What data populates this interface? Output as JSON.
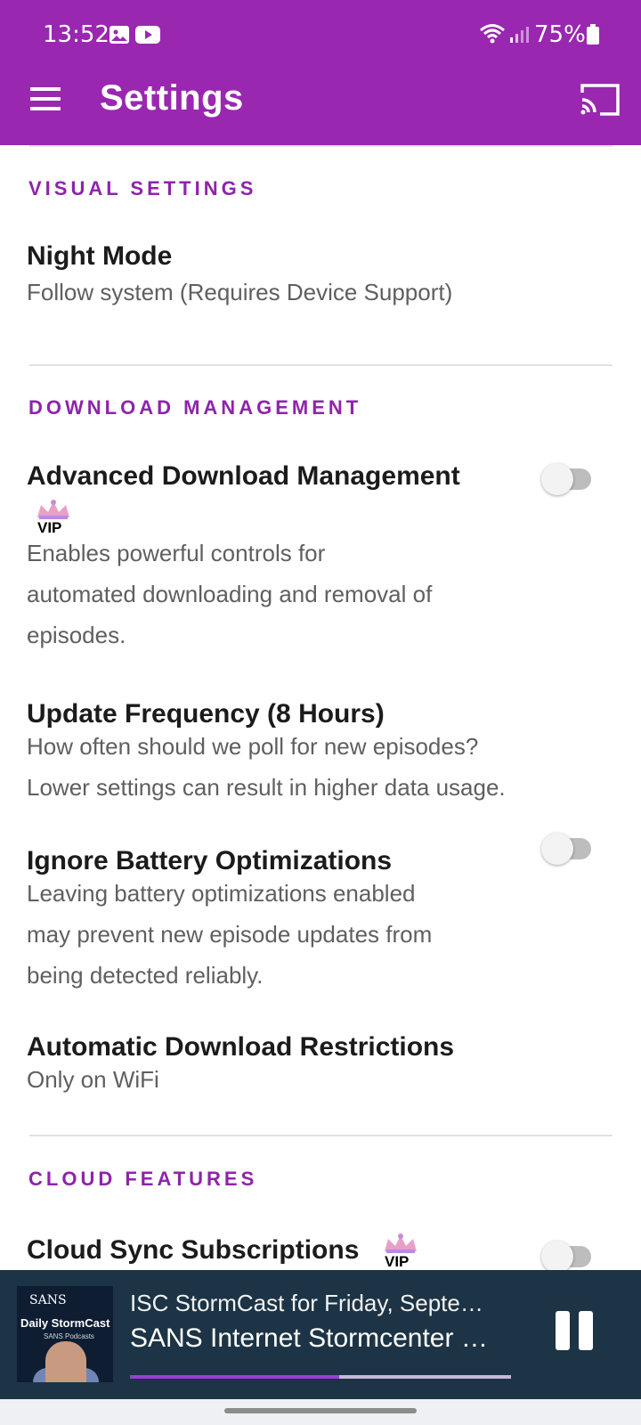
{
  "status_bar": {
    "time": "13:52",
    "battery": "75%",
    "icons": [
      "gallery-icon",
      "youtube-icon",
      "wifi-icon",
      "signal-icon",
      "battery-icon"
    ]
  },
  "appbar": {
    "title": "Settings",
    "background": "#9a27b0",
    "menu_icon": "hamburger-menu-icon",
    "cast_icon": "cast-icon"
  },
  "sections": {
    "visual": {
      "header": "VISUAL SETTINGS",
      "night_mode_title": "Night Mode",
      "night_mode_sub": "Follow system (Requires Device Support)"
    },
    "download": {
      "header": "DOWNLOAD MANAGEMENT",
      "adm_title": "Advanced Download Management",
      "adm_vip": "VIP",
      "adm_sub_1": "Enables powerful controls for",
      "adm_sub_2": "automated downloading and removal of",
      "adm_sub_3": "episodes.",
      "adm_enabled": false,
      "uf_title": "Update Frequency (8 Hours)",
      "uf_sub_1": "How often should we poll for new episodes?",
      "uf_sub_2": "Lower settings can result in higher data usage.",
      "ibo_title": "Ignore Battery Optimizations",
      "ibo_sub_1": "Leaving battery optimizations enabled",
      "ibo_sub_2": "may prevent new episode updates from",
      "ibo_sub_3": "being detected reliably.",
      "ibo_enabled": false,
      "adr_title": "Automatic Download Restrictions",
      "adr_sub": "Only on WiFi"
    },
    "cloud": {
      "header": "CLOUD FEATURES",
      "css_title": "Cloud Sync Subscriptions",
      "css_vip": "VIP",
      "css_enabled": false
    }
  },
  "accent_color": "#8e24aa",
  "player": {
    "art_brand": "SANS",
    "art_show": "Daily StormCast",
    "art_sub": "SANS Podcasts",
    "episode_title": "ISC StormCast for Friday, Septe…",
    "podcast_name": "SANS Internet Stormcenter …",
    "progress_fraction": 0.55,
    "pause_icon": "pause-icon"
  }
}
